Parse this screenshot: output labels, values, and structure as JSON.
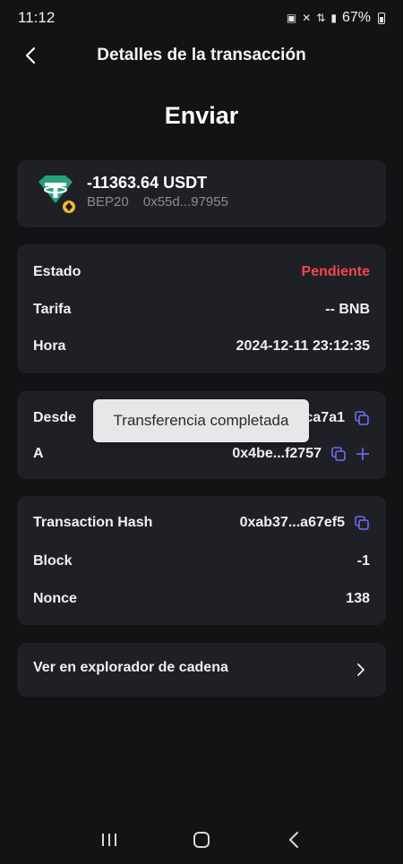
{
  "status_bar": {
    "time": "11:12",
    "battery_percent": "67%",
    "icons": [
      "battery-saver-icon",
      "mute-icon",
      "data-icon",
      "signal-icon",
      "battery-icon"
    ]
  },
  "header": {
    "title": "Detalles de la transacción",
    "back_icon": "chevron-left-icon"
  },
  "page_title": "Enviar",
  "asset": {
    "amount": "-11363.64 USDT",
    "network": "BEP20",
    "address": "0x55d...97955",
    "icon": "usdt-icon",
    "badge_icon": "bnb-badge-icon",
    "brand_color": "#26a17b",
    "badge_color": "#f3ba2f"
  },
  "info": {
    "status_label": "Estado",
    "status_value": "Pendiente",
    "status_color": "#f0474f",
    "fee_label": "Tarifa",
    "fee_value": "-- BNB",
    "time_label": "Hora",
    "time_value": "2024-12-11 23:12:35"
  },
  "addresses": {
    "from_label": "Desde",
    "from_value": "...ca7a1",
    "to_label": "A",
    "to_value": "0x4be...f2757"
  },
  "toast": {
    "text": "Transferencia completada"
  },
  "chain": {
    "hash_label": "Transaction Hash",
    "hash_value": "0xab37...a67ef5",
    "block_label": "Block",
    "block_value": "-1",
    "nonce_label": "Nonce",
    "nonce_value": "138"
  },
  "explorer": {
    "label": "Ver en explorador de cadena"
  },
  "accent_color": "#6b6ff2"
}
